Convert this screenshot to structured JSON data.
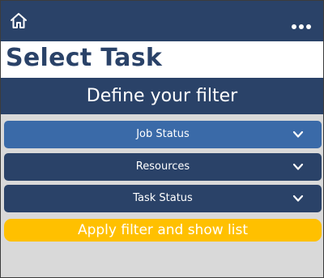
{
  "header": {
    "home_icon": "home-icon",
    "more_icon": "more-horizontal-icon"
  },
  "page": {
    "title": "Select Task",
    "subtitle": "Define your filter"
  },
  "filters": [
    {
      "label": "Job Status",
      "icon": "chevron-down-icon",
      "active": true
    },
    {
      "label": "Resources",
      "icon": "chevron-down-icon",
      "active": false
    },
    {
      "label": "Task Status",
      "icon": "chevron-down-icon",
      "active": false
    }
  ],
  "apply_button": {
    "label": "Apply filter and show list"
  },
  "colors": {
    "primary": "#2a4268",
    "active_row": "#3a6aa8",
    "accent": "#ffc000",
    "background": "#d9d9d9"
  }
}
